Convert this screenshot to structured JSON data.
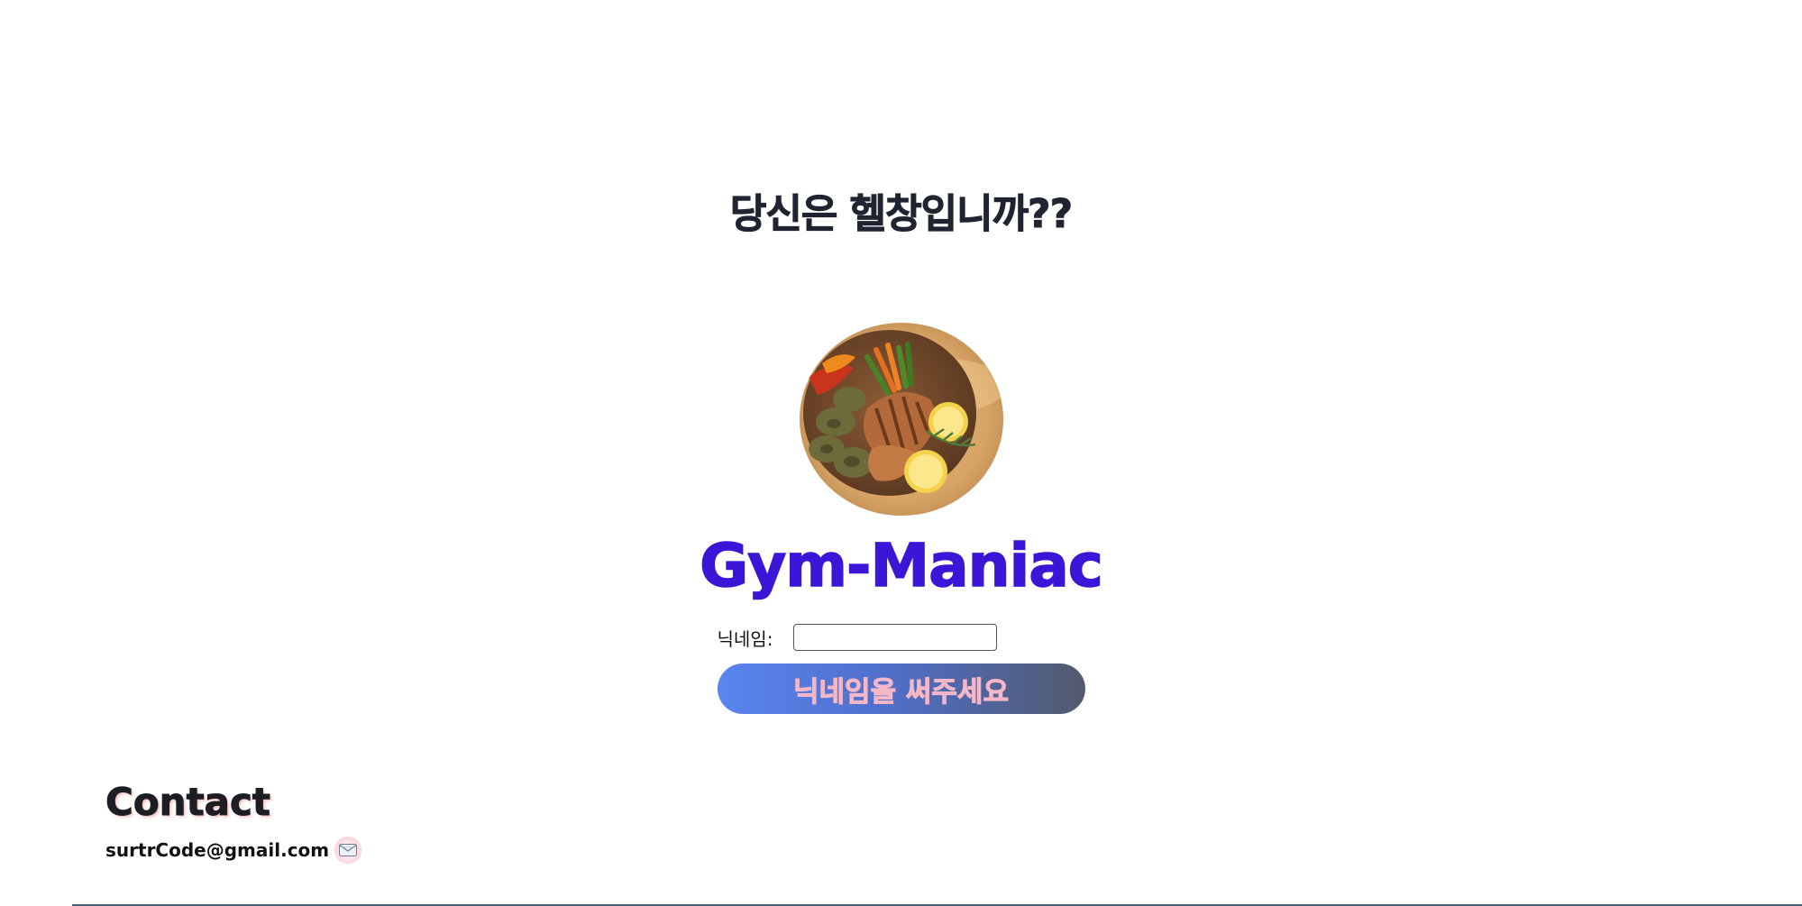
{
  "header": {
    "question": "당신은 헬창입니까??"
  },
  "brand": {
    "title": "Gym-Maniac"
  },
  "form": {
    "nickname_label": "닉네임:",
    "nickname_value": "",
    "submit_label": "닉네임을 써주세요"
  },
  "contact": {
    "title": "Contact",
    "email": "surtrCode@gmail.com",
    "icon": "envelope-icon"
  },
  "colors": {
    "brand": "#3b16d6",
    "button_gradient_start": "#5a86f0",
    "button_gradient_end": "#535a6c",
    "button_text": "#f4b7c7"
  }
}
